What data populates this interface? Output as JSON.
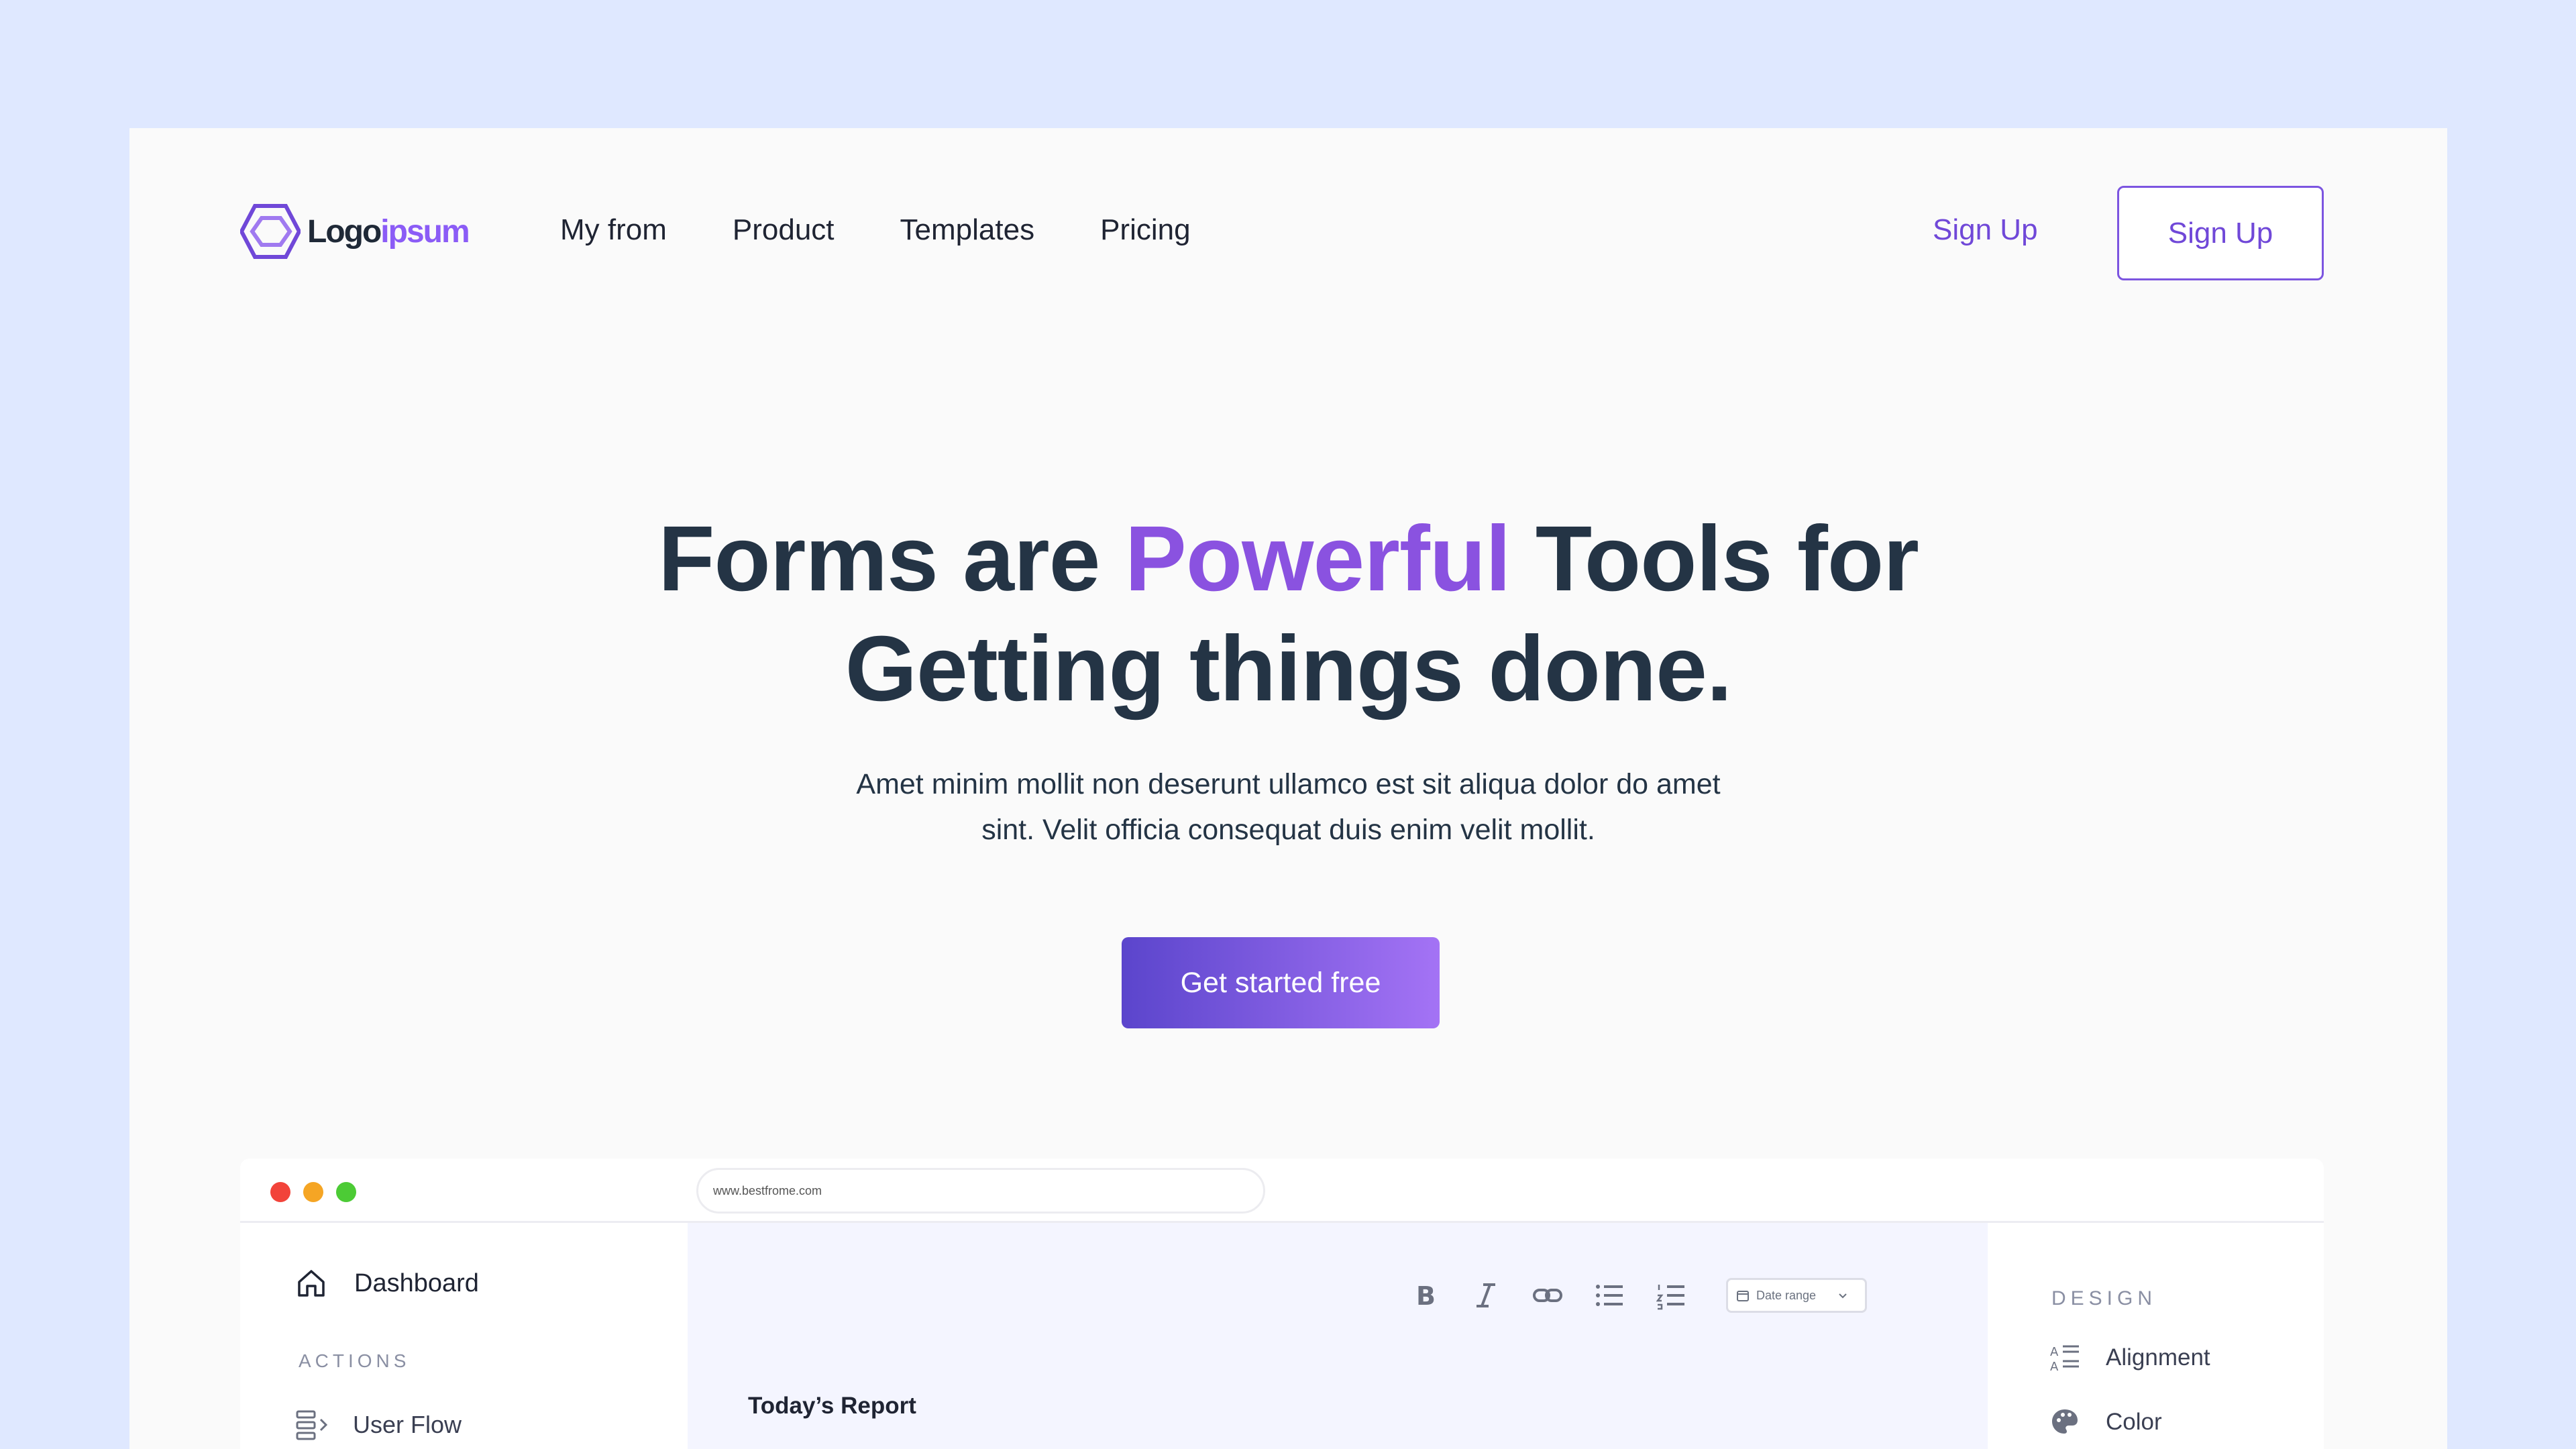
{
  "brand": {
    "name_part1": "Logo",
    "name_part2": "ipsum",
    "accent_color": "#8b5cf6"
  },
  "nav": {
    "links": [
      "My from",
      "Product",
      "Templates",
      "Pricing"
    ],
    "signup_link": "Sign Up",
    "signup_button": "Sign Up"
  },
  "hero": {
    "title_part1": "Forms are ",
    "title_accent": "Powerful",
    "title_part2": " Tools for",
    "title_line2": "Getting things done.",
    "subtitle_line1": "Amet minim mollit non deserunt ullamco est sit aliqua dolor do amet",
    "subtitle_line2": "sint. Velit officia consequat duis enim velit mollit.",
    "cta_label": "Get started free"
  },
  "mockup": {
    "url": "www.bestfrome.com",
    "sidebar": {
      "dashboard_label": "Dashboard",
      "section_label": "ACTIONS",
      "items": [
        "User Flow"
      ]
    },
    "toolbar": {
      "icons": [
        "bold-icon",
        "italic-icon",
        "link-icon",
        "bullet-list-icon",
        "numbered-list-icon"
      ],
      "date_range_label": "Date range"
    },
    "report_title": "Today’s Report",
    "design_panel": {
      "section_label": "DESIGN",
      "items": [
        "Alignment",
        "Color"
      ]
    }
  }
}
